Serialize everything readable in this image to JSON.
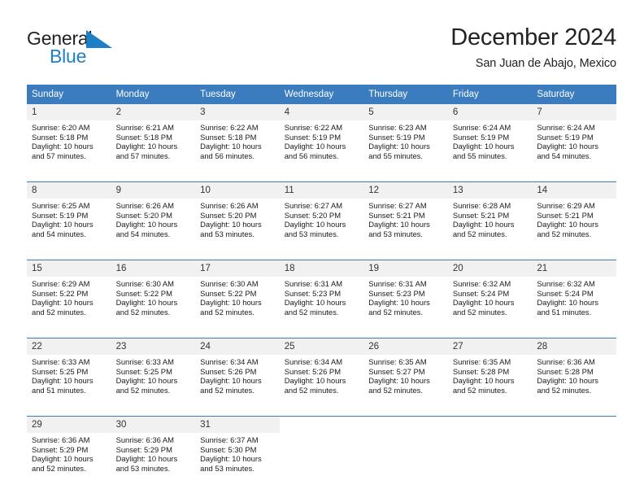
{
  "brand": {
    "name_part1": "General",
    "name_part2": "Blue",
    "logo_icon": "triangle-flag-icon",
    "accent_color": "#1f7fc4"
  },
  "header": {
    "title": "December 2024",
    "location": "San Juan de Abajo, Mexico"
  },
  "colors": {
    "header_blue": "#3b7cbe",
    "daynum_background": "#f1f1f1",
    "text": "#1a1a1a"
  },
  "calendar": {
    "weekday_headers": [
      "Sunday",
      "Monday",
      "Tuesday",
      "Wednesday",
      "Thursday",
      "Friday",
      "Saturday"
    ],
    "weeks": [
      [
        {
          "day": "1",
          "sunrise": "Sunrise: 6:20 AM",
          "sunset": "Sunset: 5:18 PM",
          "daylight1": "Daylight: 10 hours",
          "daylight2": "and 57 minutes."
        },
        {
          "day": "2",
          "sunrise": "Sunrise: 6:21 AM",
          "sunset": "Sunset: 5:18 PM",
          "daylight1": "Daylight: 10 hours",
          "daylight2": "and 57 minutes."
        },
        {
          "day": "3",
          "sunrise": "Sunrise: 6:22 AM",
          "sunset": "Sunset: 5:18 PM",
          "daylight1": "Daylight: 10 hours",
          "daylight2": "and 56 minutes."
        },
        {
          "day": "4",
          "sunrise": "Sunrise: 6:22 AM",
          "sunset": "Sunset: 5:19 PM",
          "daylight1": "Daylight: 10 hours",
          "daylight2": "and 56 minutes."
        },
        {
          "day": "5",
          "sunrise": "Sunrise: 6:23 AM",
          "sunset": "Sunset: 5:19 PM",
          "daylight1": "Daylight: 10 hours",
          "daylight2": "and 55 minutes."
        },
        {
          "day": "6",
          "sunrise": "Sunrise: 6:24 AM",
          "sunset": "Sunset: 5:19 PM",
          "daylight1": "Daylight: 10 hours",
          "daylight2": "and 55 minutes."
        },
        {
          "day": "7",
          "sunrise": "Sunrise: 6:24 AM",
          "sunset": "Sunset: 5:19 PM",
          "daylight1": "Daylight: 10 hours",
          "daylight2": "and 54 minutes."
        }
      ],
      [
        {
          "day": "8",
          "sunrise": "Sunrise: 6:25 AM",
          "sunset": "Sunset: 5:19 PM",
          "daylight1": "Daylight: 10 hours",
          "daylight2": "and 54 minutes."
        },
        {
          "day": "9",
          "sunrise": "Sunrise: 6:26 AM",
          "sunset": "Sunset: 5:20 PM",
          "daylight1": "Daylight: 10 hours",
          "daylight2": "and 54 minutes."
        },
        {
          "day": "10",
          "sunrise": "Sunrise: 6:26 AM",
          "sunset": "Sunset: 5:20 PM",
          "daylight1": "Daylight: 10 hours",
          "daylight2": "and 53 minutes."
        },
        {
          "day": "11",
          "sunrise": "Sunrise: 6:27 AM",
          "sunset": "Sunset: 5:20 PM",
          "daylight1": "Daylight: 10 hours",
          "daylight2": "and 53 minutes."
        },
        {
          "day": "12",
          "sunrise": "Sunrise: 6:27 AM",
          "sunset": "Sunset: 5:21 PM",
          "daylight1": "Daylight: 10 hours",
          "daylight2": "and 53 minutes."
        },
        {
          "day": "13",
          "sunrise": "Sunrise: 6:28 AM",
          "sunset": "Sunset: 5:21 PM",
          "daylight1": "Daylight: 10 hours",
          "daylight2": "and 52 minutes."
        },
        {
          "day": "14",
          "sunrise": "Sunrise: 6:29 AM",
          "sunset": "Sunset: 5:21 PM",
          "daylight1": "Daylight: 10 hours",
          "daylight2": "and 52 minutes."
        }
      ],
      [
        {
          "day": "15",
          "sunrise": "Sunrise: 6:29 AM",
          "sunset": "Sunset: 5:22 PM",
          "daylight1": "Daylight: 10 hours",
          "daylight2": "and 52 minutes."
        },
        {
          "day": "16",
          "sunrise": "Sunrise: 6:30 AM",
          "sunset": "Sunset: 5:22 PM",
          "daylight1": "Daylight: 10 hours",
          "daylight2": "and 52 minutes."
        },
        {
          "day": "17",
          "sunrise": "Sunrise: 6:30 AM",
          "sunset": "Sunset: 5:22 PM",
          "daylight1": "Daylight: 10 hours",
          "daylight2": "and 52 minutes."
        },
        {
          "day": "18",
          "sunrise": "Sunrise: 6:31 AM",
          "sunset": "Sunset: 5:23 PM",
          "daylight1": "Daylight: 10 hours",
          "daylight2": "and 52 minutes."
        },
        {
          "day": "19",
          "sunrise": "Sunrise: 6:31 AM",
          "sunset": "Sunset: 5:23 PM",
          "daylight1": "Daylight: 10 hours",
          "daylight2": "and 52 minutes."
        },
        {
          "day": "20",
          "sunrise": "Sunrise: 6:32 AM",
          "sunset": "Sunset: 5:24 PM",
          "daylight1": "Daylight: 10 hours",
          "daylight2": "and 52 minutes."
        },
        {
          "day": "21",
          "sunrise": "Sunrise: 6:32 AM",
          "sunset": "Sunset: 5:24 PM",
          "daylight1": "Daylight: 10 hours",
          "daylight2": "and 51 minutes."
        }
      ],
      [
        {
          "day": "22",
          "sunrise": "Sunrise: 6:33 AM",
          "sunset": "Sunset: 5:25 PM",
          "daylight1": "Daylight: 10 hours",
          "daylight2": "and 51 minutes."
        },
        {
          "day": "23",
          "sunrise": "Sunrise: 6:33 AM",
          "sunset": "Sunset: 5:25 PM",
          "daylight1": "Daylight: 10 hours",
          "daylight2": "and 52 minutes."
        },
        {
          "day": "24",
          "sunrise": "Sunrise: 6:34 AM",
          "sunset": "Sunset: 5:26 PM",
          "daylight1": "Daylight: 10 hours",
          "daylight2": "and 52 minutes."
        },
        {
          "day": "25",
          "sunrise": "Sunrise: 6:34 AM",
          "sunset": "Sunset: 5:26 PM",
          "daylight1": "Daylight: 10 hours",
          "daylight2": "and 52 minutes."
        },
        {
          "day": "26",
          "sunrise": "Sunrise: 6:35 AM",
          "sunset": "Sunset: 5:27 PM",
          "daylight1": "Daylight: 10 hours",
          "daylight2": "and 52 minutes."
        },
        {
          "day": "27",
          "sunrise": "Sunrise: 6:35 AM",
          "sunset": "Sunset: 5:28 PM",
          "daylight1": "Daylight: 10 hours",
          "daylight2": "and 52 minutes."
        },
        {
          "day": "28",
          "sunrise": "Sunrise: 6:36 AM",
          "sunset": "Sunset: 5:28 PM",
          "daylight1": "Daylight: 10 hours",
          "daylight2": "and 52 minutes."
        }
      ],
      [
        {
          "day": "29",
          "sunrise": "Sunrise: 6:36 AM",
          "sunset": "Sunset: 5:29 PM",
          "daylight1": "Daylight: 10 hours",
          "daylight2": "and 52 minutes."
        },
        {
          "day": "30",
          "sunrise": "Sunrise: 6:36 AM",
          "sunset": "Sunset: 5:29 PM",
          "daylight1": "Daylight: 10 hours",
          "daylight2": "and 53 minutes."
        },
        {
          "day": "31",
          "sunrise": "Sunrise: 6:37 AM",
          "sunset": "Sunset: 5:30 PM",
          "daylight1": "Daylight: 10 hours",
          "daylight2": "and 53 minutes."
        },
        {
          "day": "",
          "sunrise": "",
          "sunset": "",
          "daylight1": "",
          "daylight2": ""
        },
        {
          "day": "",
          "sunrise": "",
          "sunset": "",
          "daylight1": "",
          "daylight2": ""
        },
        {
          "day": "",
          "sunrise": "",
          "sunset": "",
          "daylight1": "",
          "daylight2": ""
        },
        {
          "day": "",
          "sunrise": "",
          "sunset": "",
          "daylight1": "",
          "daylight2": ""
        }
      ]
    ]
  }
}
